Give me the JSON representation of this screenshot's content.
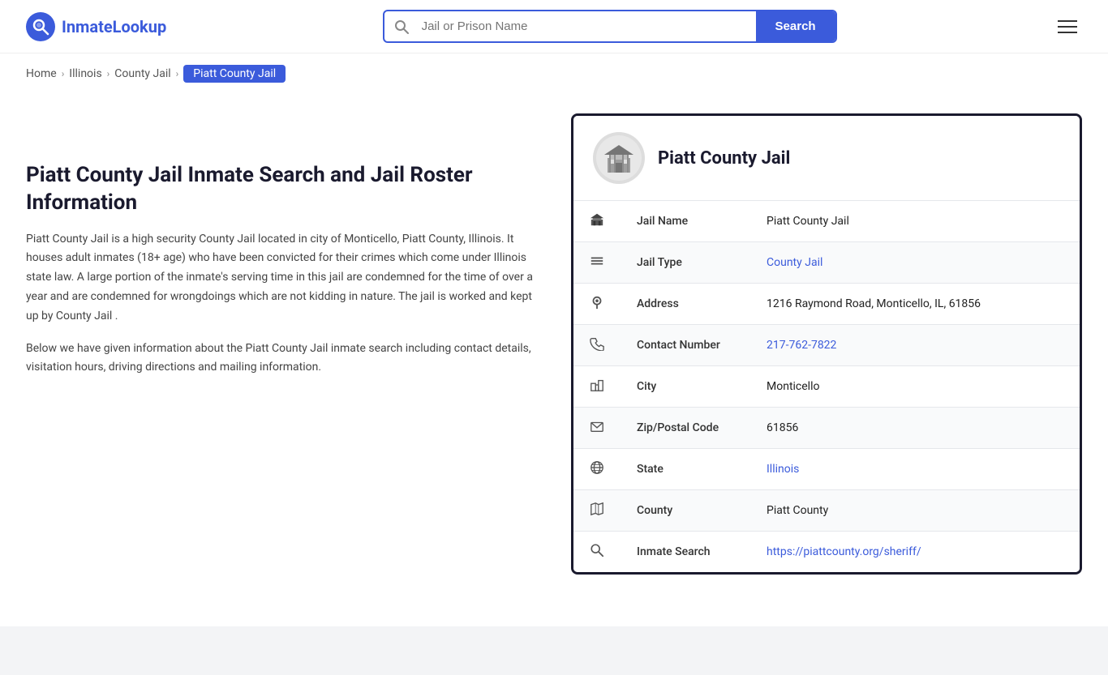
{
  "header": {
    "logo_name": "InmateLookup",
    "logo_highlight": "Inmate",
    "search_placeholder": "Jail or Prison Name",
    "search_button_label": "Search"
  },
  "breadcrumb": {
    "items": [
      {
        "label": "Home",
        "href": "#"
      },
      {
        "label": "Illinois",
        "href": "#"
      },
      {
        "label": "County Jail",
        "href": "#"
      },
      {
        "label": "Piatt County Jail",
        "active": true
      }
    ]
  },
  "left": {
    "title": "Piatt County Jail Inmate Search and Jail Roster Information",
    "description1": "Piatt County Jail is a high security County Jail located in city of Monticello, Piatt County, Illinois. It houses adult inmates (18+ age) who have been convicted for their crimes which come under Illinois state law. A large portion of the inmate's serving time in this jail are condemned for the time of over a year and are condemned for wrongdoings which are not kidding in nature. The jail is worked and kept up by County Jail .",
    "description2": "Below we have given information about the Piatt County Jail inmate search including contact details, visitation hours, driving directions and mailing information."
  },
  "jail": {
    "name": "Piatt County Jail",
    "fields": [
      {
        "icon": "🏛",
        "label": "Jail Name",
        "value": "Piatt County Jail",
        "link": null
      },
      {
        "icon": "≡",
        "label": "Jail Type",
        "value": "County Jail",
        "link": "#"
      },
      {
        "icon": "📍",
        "label": "Address",
        "value": "1216 Raymond Road, Monticello, IL, 61856",
        "link": null
      },
      {
        "icon": "📞",
        "label": "Contact Number",
        "value": "217-762-7822",
        "link": "tel:2177627822"
      },
      {
        "icon": "🏙",
        "label": "City",
        "value": "Monticello",
        "link": null
      },
      {
        "icon": "✉",
        "label": "Zip/Postal Code",
        "value": "61856",
        "link": null
      },
      {
        "icon": "🌐",
        "label": "State",
        "value": "Illinois",
        "link": "#"
      },
      {
        "icon": "🗺",
        "label": "County",
        "value": "Piatt County",
        "link": null
      },
      {
        "icon": "🔎",
        "label": "Inmate Search",
        "value": "https://piattcounty.org/sheriff/",
        "link": "https://piattcounty.org/sheriff/"
      }
    ]
  },
  "icons": {
    "search": "🔍",
    "menu": "☰"
  }
}
